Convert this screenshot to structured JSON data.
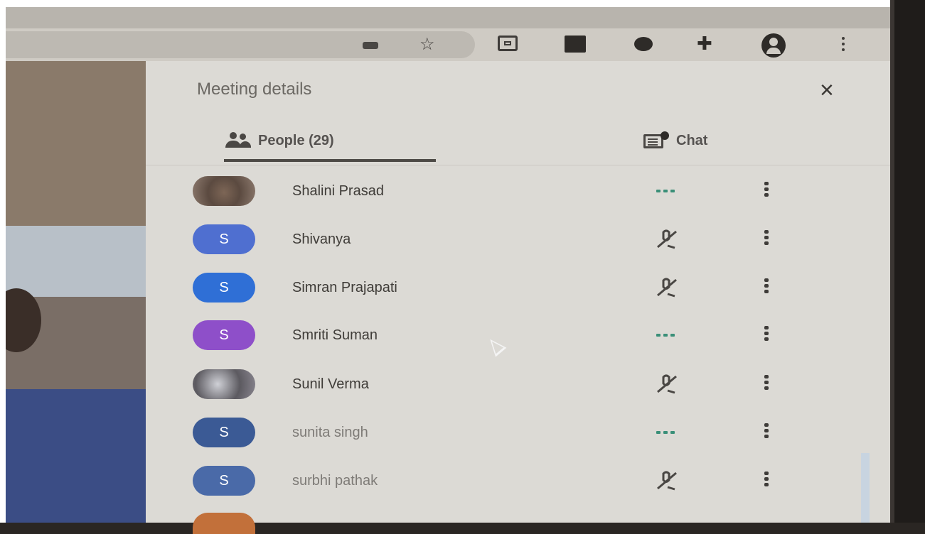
{
  "toolbar": {
    "icons": [
      "key-icon",
      "star-icon",
      "extension-cast-icon",
      "extension-square-icon",
      "extension-speech-icon",
      "puzzle-icon",
      "profile-icon",
      "menu-icon"
    ]
  },
  "panel": {
    "title": "Meeting details",
    "close_icon": "×",
    "tabs": {
      "people_label": "People (29)",
      "chat_label": "Chat"
    },
    "participants": [
      {
        "name": "Shalini Prasad",
        "initial": "",
        "avatar": "photo",
        "status": "speaking"
      },
      {
        "name": "Shivanya",
        "initial": "S",
        "avatar_color": "#4f6fd0",
        "status": "muted"
      },
      {
        "name": "Simran Prajapati",
        "initial": "S",
        "avatar_color": "#2f6fd6",
        "status": "muted"
      },
      {
        "name": "Smriti Suman",
        "initial": "S",
        "avatar_color": "#8e4fc9",
        "status": "speaking"
      },
      {
        "name": "Sunil Verma",
        "initial": "",
        "avatar": "photo",
        "status": "muted"
      },
      {
        "name": "sunita singh",
        "initial": "S",
        "avatar_color": "#3b5a95",
        "status": "speaking"
      },
      {
        "name": "surbhi pathak",
        "initial": "S",
        "avatar_color": "#4a6aa8",
        "status": "muted"
      }
    ],
    "status_glyphs": {
      "muted": "🎙̸",
      "speaking": "•••"
    }
  },
  "colors": {
    "panel_bg": "#dcdad5",
    "speaking_dots": "#3a8f78"
  }
}
